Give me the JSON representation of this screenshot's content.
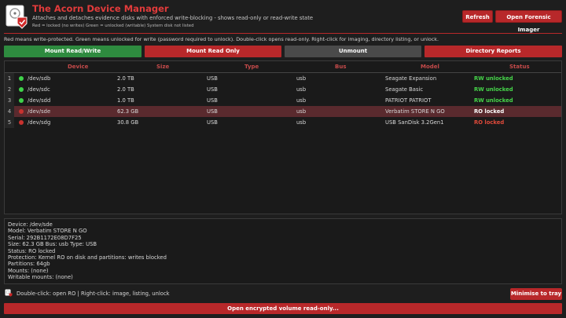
{
  "app": {
    "title": "The Acorn Device Manager",
    "subtitle": "Attaches and detaches evidence disks with enforced write-blocking - shows read-only or read-write state",
    "legend": "Red = locked (no writes)   Green = unlocked (writable)   System disk not listed"
  },
  "header_buttons": {
    "refresh": "Refresh",
    "forensic": "Open Forensic Imager"
  },
  "info_text": "Red means write-protected. Green means unlocked for write (password required to unlock). Double-click opens read-only. Right-click for imaging, directory listing, or unlock.",
  "actions": {
    "mount_rw": "Mount Read/Write",
    "mount_ro": "Mount Read Only",
    "unmount": "Unmount",
    "dir_reports": "Directory Reports"
  },
  "table": {
    "columns": [
      "Device",
      "Size",
      "Type",
      "Bus",
      "Model",
      "Status"
    ],
    "rows": [
      {
        "num": "1",
        "device": "/dev/sdb",
        "size": "2.0 TB",
        "type": "USB",
        "bus": "usb",
        "model": "Seagate Expansion",
        "status": "RW unlocked",
        "state": "unlocked"
      },
      {
        "num": "2",
        "device": "/dev/sdc",
        "size": "2.0 TB",
        "type": "USB",
        "bus": "usb",
        "model": "Seagate Basic",
        "status": "RW unlocked",
        "state": "unlocked"
      },
      {
        "num": "3",
        "device": "/dev/sdd",
        "size": "1.0 TB",
        "type": "USB",
        "bus": "usb",
        "model": "PATRIOT PATRIOT",
        "status": "RW unlocked",
        "state": "unlocked"
      },
      {
        "num": "4",
        "device": "/dev/sde",
        "size": "62.3 GB",
        "type": "USB",
        "bus": "usb",
        "model": "Verbatim STORE N GO",
        "status": "RO locked",
        "state": "locked"
      },
      {
        "num": "5",
        "device": "/dev/sdg",
        "size": "30.8 GB",
        "type": "USB",
        "bus": "usb",
        "model": "USB SanDisk 3.2Gen1",
        "status": "RO locked",
        "state": "locked"
      }
    ]
  },
  "details": {
    "lines": [
      "Device: /dev/sde",
      "Model: Verbatim STORE N GO",
      "Serial: 292B1172E08D7F25",
      "Size: 62.3 GB  Bus: usb  Type: USB",
      "Status: RO locked",
      "Protection: Kernel RO on disk and partitions: writes blocked",
      "Partitions: 64gb",
      "Mounts: (none)",
      "Writable mounts: (none)"
    ]
  },
  "footer": {
    "hint": "Double-click: open RO  |  Right-click: image, listing, unlock",
    "minimise": "Minimise to tray",
    "encrypted": "Open encrypted volume read-only..."
  },
  "colors": {
    "accent_red": "#b8282a",
    "unlocked_green": "#3fd34a",
    "locked_red": "#c8322f"
  }
}
